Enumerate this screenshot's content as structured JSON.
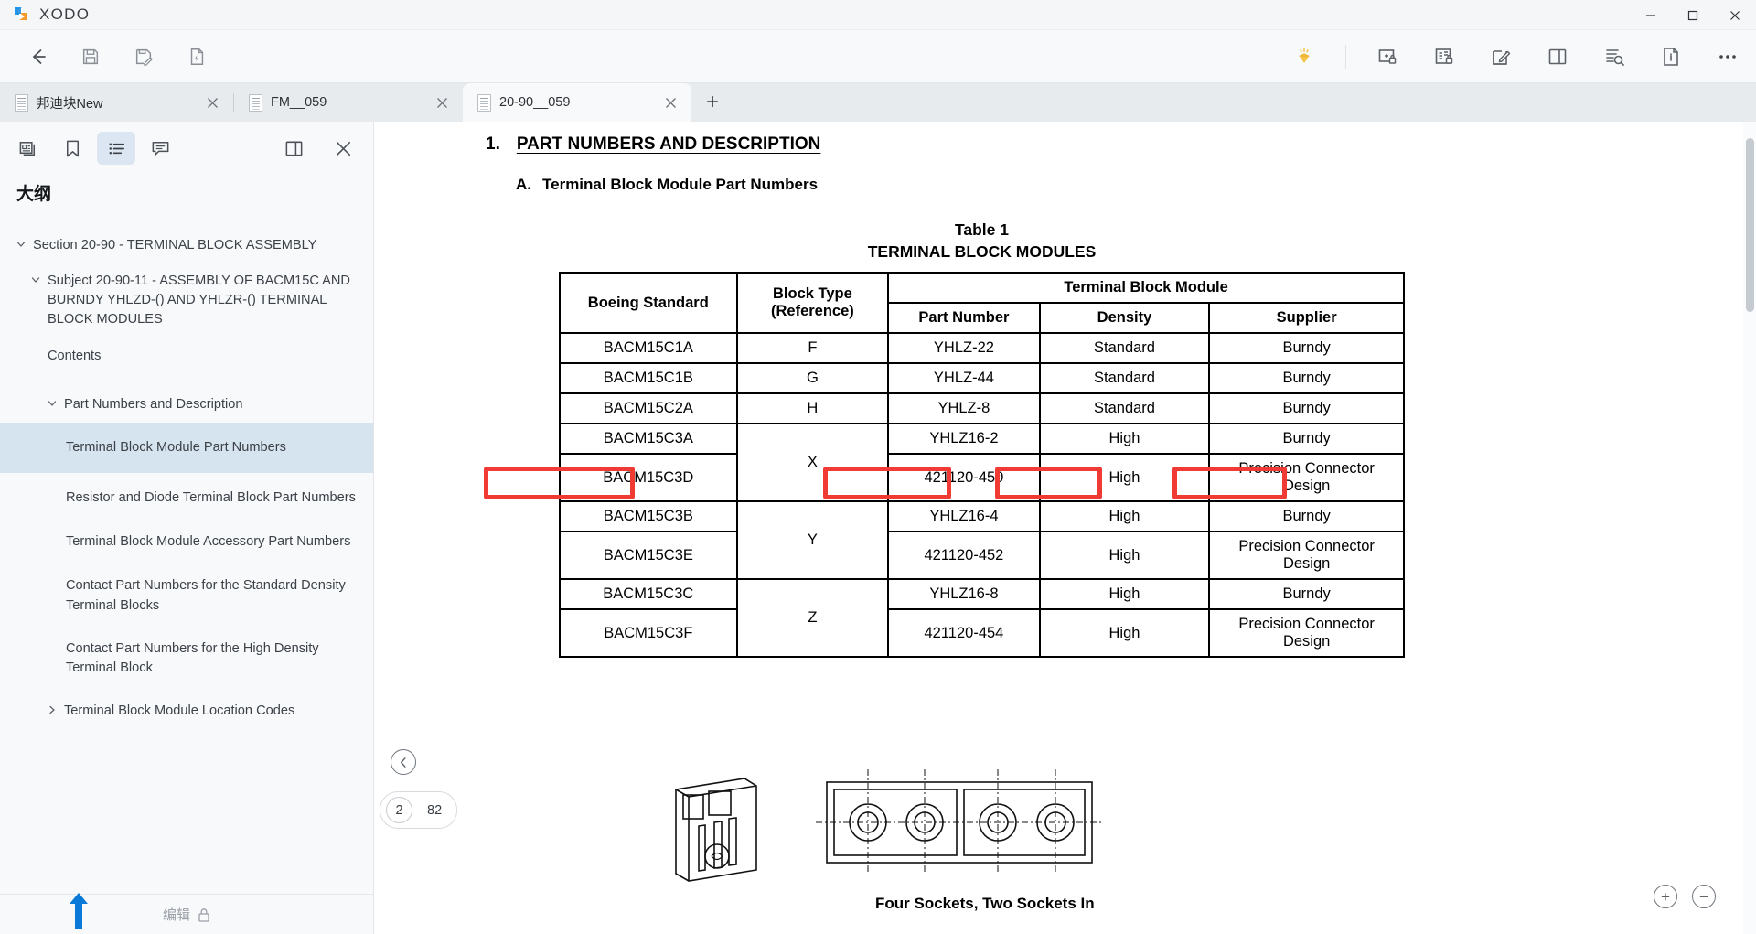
{
  "app": {
    "brand": "XODO",
    "window_controls": {
      "minimize": "─",
      "maximize": "☐",
      "close": "✕"
    }
  },
  "toolbar": {
    "left": [
      {
        "name": "back-icon",
        "label": "Back"
      },
      {
        "name": "save-icon",
        "label": "Save"
      },
      {
        "name": "save-as-icon",
        "label": "Save As"
      },
      {
        "name": "export-icon",
        "label": "Export"
      }
    ],
    "right": [
      {
        "name": "diamond-premium-icon",
        "label": "Premium",
        "color": "#f5bc42"
      },
      {
        "name": "protect-page-icon",
        "label": "Protect Page"
      },
      {
        "name": "protect-document-icon",
        "label": "Protect Document"
      },
      {
        "name": "edit-icon",
        "label": "Edit"
      },
      {
        "name": "panel-layout-icon",
        "label": "Panel Layout"
      },
      {
        "name": "search-document-icon",
        "label": "Search Document"
      },
      {
        "name": "page-info-icon",
        "label": "Page Info"
      },
      {
        "name": "more-options-icon",
        "label": "More"
      }
    ]
  },
  "tabs": [
    {
      "label": "邦迪块New",
      "active": false
    },
    {
      "label": "FM__059",
      "active": false
    },
    {
      "label": "20-90__059",
      "active": true
    }
  ],
  "tab_add_label": "+",
  "sidebar": {
    "panel_tabs": [
      {
        "name": "thumbnails-icon",
        "active": false
      },
      {
        "name": "bookmark-icon",
        "active": false
      },
      {
        "name": "outline-icon",
        "active": true
      },
      {
        "name": "comments-icon",
        "active": false
      }
    ],
    "panel_actions": [
      {
        "name": "split-panel-icon"
      },
      {
        "name": "close-panel-icon"
      }
    ],
    "title": "大纲",
    "outline": [
      {
        "label": "Section 20-90 - TERMINAL BLOCK ASSEMBLY",
        "level": 0,
        "caret": "down",
        "selected": false
      },
      {
        "label": "Subject 20-90-11 - ASSEMBLY OF BACM15C AND BURNDY YHLZD-() AND YHLZR-() TERMINAL BLOCK MODULES",
        "level": 1,
        "caret": "down",
        "selected": false
      },
      {
        "label": "Contents",
        "level": 1,
        "caret": "none",
        "selected": false
      },
      {
        "label": "Part Numbers and Description",
        "level": 2,
        "caret": "down",
        "selected": false
      },
      {
        "label": "Terminal Block Module Part Numbers",
        "level": 3,
        "caret": "none",
        "selected": true
      },
      {
        "label": "Resistor and Diode Terminal Block Part Numbers",
        "level": 3,
        "caret": "none",
        "selected": false
      },
      {
        "label": "Terminal Block Module Accessory Part Numbers",
        "level": 3,
        "caret": "none",
        "selected": false
      },
      {
        "label": "Contact Part Numbers for the Standard Density Terminal Blocks",
        "level": 3,
        "caret": "none",
        "selected": false
      },
      {
        "label": "Contact Part Numbers for the High Density Terminal Block",
        "level": 3,
        "caret": "none",
        "selected": false
      },
      {
        "label": "Terminal Block Module Location Codes",
        "level": 2,
        "caret": "right",
        "selected": false
      }
    ],
    "footer": {
      "label": "编辑",
      "icon": "lock-icon"
    }
  },
  "document": {
    "section_number": "1.",
    "section_title": "PART NUMBERS AND DESCRIPTION",
    "sub_letter": "A.",
    "sub_title": "Terminal Block Module Part Numbers",
    "table_label": "Table 1",
    "table_title": "TERMINAL BLOCK MODULES",
    "table": {
      "group_header": "Terminal Block Module",
      "headers": [
        "Boeing Standard",
        "Block Type\n(Reference)",
        "Part Number",
        "Density",
        "Supplier"
      ],
      "headers_flat": {
        "boeing_standard": "Boeing Standard",
        "block_type_line1": "Block Type",
        "block_type_line2": "(Reference)",
        "part_number": "Part Number",
        "density": "Density",
        "supplier": "Supplier"
      },
      "rows": [
        {
          "boeing": "BACM15C1A",
          "block_type": "F",
          "part_number": "YHLZ-22",
          "density": "Standard",
          "supplier": "Burndy",
          "block_rowspan": 1
        },
        {
          "boeing": "BACM15C1B",
          "block_type": "G",
          "part_number": "YHLZ-44",
          "density": "Standard",
          "supplier": "Burndy",
          "block_rowspan": 1
        },
        {
          "boeing": "BACM15C2A",
          "block_type": "H",
          "part_number": "YHLZ-8",
          "density": "Standard",
          "supplier": "Burndy",
          "block_rowspan": 1
        },
        {
          "boeing": "BACM15C3A",
          "block_type": "X",
          "part_number": "YHLZ16-2",
          "density": "High",
          "supplier": "Burndy",
          "block_rowspan": 2
        },
        {
          "boeing": "BACM15C3D",
          "block_type": "",
          "part_number": "421120-450",
          "density": "High",
          "supplier": "Precision Connector Design",
          "block_rowspan": 0
        },
        {
          "boeing": "BACM15C3B",
          "block_type": "Y",
          "part_number": "YHLZ16-4",
          "density": "High",
          "supplier": "Burndy",
          "block_rowspan": 2
        },
        {
          "boeing": "BACM15C3E",
          "block_type": "",
          "part_number": "421120-452",
          "density": "High",
          "supplier": "Precision Connector Design",
          "block_rowspan": 0
        },
        {
          "boeing": "BACM15C3C",
          "block_type": "Z",
          "part_number": "YHLZ16-8",
          "density": "High",
          "supplier": "Burndy",
          "block_rowspan": 2
        },
        {
          "boeing": "BACM15C3F",
          "block_type": "",
          "part_number": "421120-454",
          "density": "High",
          "supplier": "Precision Connector Design",
          "block_rowspan": 0
        }
      ]
    },
    "annotations": {
      "color": "#ef3b33",
      "boxes": [
        {
          "target": "BACM15C3B",
          "name": "annotation-boeing-standard"
        },
        {
          "target": "YHLZ16-4",
          "name": "annotation-part-number"
        },
        {
          "target": "High",
          "name": "annotation-density"
        },
        {
          "target": "Burndy",
          "name": "annotation-supplier"
        }
      ]
    },
    "figure_caption": "Four Sockets, Two Sockets In"
  },
  "viewer": {
    "back_button": "←",
    "page_current": "2",
    "page_total": "82",
    "zoom_in": "+",
    "zoom_out": "−"
  }
}
